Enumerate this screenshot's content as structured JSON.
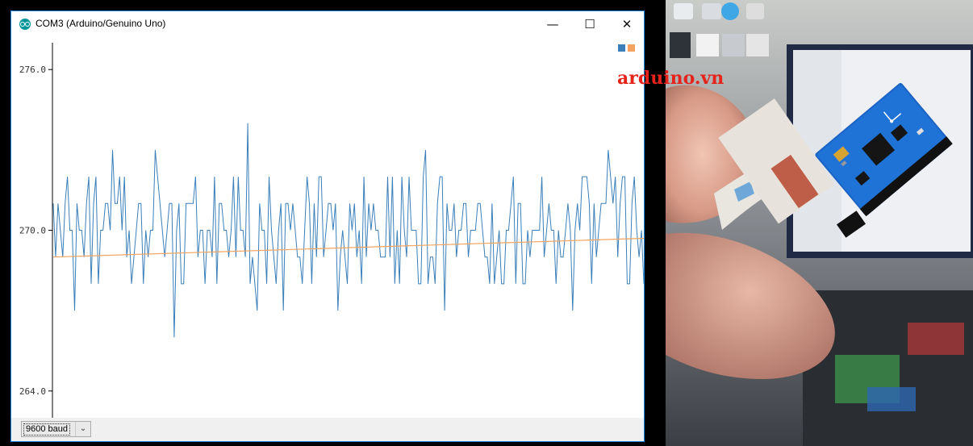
{
  "window": {
    "title": "COM3 (Arduino/Genuino Uno)",
    "controls": {
      "minimize": "—",
      "maximize": "☐",
      "close": "✕"
    }
  },
  "footer": {
    "baud_rate": "9600 baud"
  },
  "watermark": "arduino.vn",
  "colors": {
    "series1": "#3a7fb9",
    "series2": "#f4a460",
    "window_border": "#1883d7"
  },
  "chart_data": {
    "type": "line",
    "ylim": [
      263.0,
      277.0
    ],
    "yticks": [
      264.0,
      270.0,
      276.0
    ],
    "ytick_labels": [
      "264.0",
      "270.0",
      "276.0"
    ],
    "grid": false,
    "legend": "top-right",
    "x_count": 250,
    "series": [
      {
        "color": "#3a7fb9",
        "values": [
          271,
          269,
          271,
          270,
          269,
          271,
          272,
          270,
          270,
          267,
          271,
          270,
          270,
          269,
          271,
          272,
          268,
          271,
          272,
          268,
          270,
          270,
          271,
          271,
          270,
          273,
          271,
          271,
          272,
          270,
          272,
          269,
          270,
          268,
          269,
          270,
          271,
          271,
          268,
          270,
          269,
          270,
          270,
          273,
          272,
          271,
          270,
          269,
          270,
          271,
          271,
          266,
          270,
          271,
          268,
          268,
          271,
          271,
          271,
          271,
          272,
          269,
          270,
          270,
          268,
          270,
          270,
          269,
          272,
          268,
          271,
          271,
          270,
          270,
          269,
          270,
          272,
          269,
          272,
          270,
          270,
          269,
          274,
          268,
          269,
          268,
          267,
          271,
          270,
          270,
          268,
          272,
          270,
          269,
          268,
          270,
          271,
          267,
          271,
          271,
          270,
          271,
          270,
          269,
          269,
          268,
          270,
          272,
          271,
          268,
          271,
          269,
          272,
          272,
          269,
          270,
          271,
          271,
          270,
          271,
          267,
          269,
          270,
          269,
          268,
          271,
          270,
          271,
          269,
          270,
          268,
          272,
          269,
          271,
          270,
          271,
          270,
          270,
          269,
          269,
          269,
          272,
          269,
          272,
          268,
          270,
          268,
          272,
          270,
          269,
          272,
          270,
          270,
          270,
          268,
          268,
          272,
          273,
          268,
          269,
          269,
          268,
          271,
          272,
          272,
          267,
          271,
          270,
          270,
          271,
          269,
          270,
          270,
          271,
          271,
          269,
          270,
          270,
          270,
          271,
          271,
          270,
          269,
          269,
          268,
          271,
          268,
          269,
          270,
          268,
          268,
          270,
          270,
          271,
          272,
          268,
          271,
          271,
          268,
          268,
          270,
          269,
          270,
          270,
          270,
          270,
          272,
          269,
          270,
          271,
          270,
          270,
          268,
          270,
          269,
          269,
          270,
          271,
          270,
          267,
          270,
          271,
          270,
          272,
          272,
          272,
          271,
          268,
          271,
          269,
          270,
          271,
          271,
          271,
          273,
          272,
          271,
          272,
          269,
          271,
          272,
          272,
          268,
          268,
          271,
          272,
          270,
          269,
          270,
          268
        ]
      },
      {
        "color": "#f4a460",
        "values": [
          269.0,
          269.7
        ]
      }
    ]
  }
}
